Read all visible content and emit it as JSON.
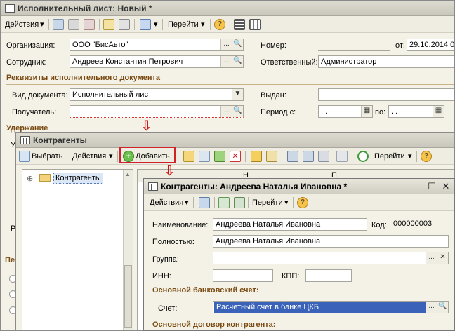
{
  "main_window": {
    "title": "Исполнительный лист: Новый *",
    "toolbar": {
      "actions": "Действия",
      "goto": "Перейти"
    },
    "org_label": "Организация:",
    "org_value": "ООО \"БисАвто\"",
    "number_label": "Номер:",
    "number_value": "",
    "date_label": "от:",
    "date_value": "29.10.2014  0",
    "employee_label": "Сотрудник:",
    "employee_value": "Андреев Константин Петрович",
    "responsible_label": "Ответственный:",
    "responsible_value": "Администратор",
    "section_requisites": "Реквизиты исполнительного документа",
    "doc_type_label": "Вид документа:",
    "doc_type_value": "Исполнительный лист",
    "issued_label": "Выдан:",
    "issued_value": "",
    "recipient_label": "Получатель:",
    "recipient_value": "",
    "period_label": "Период с:",
    "period_from": " .  .",
    "period_to_label": "по:",
    "period_to": " .  .",
    "section_deduction": "Удержание",
    "partial_labels": {
      "u": "У",
      "r": "Р",
      "pe": "Пе"
    }
  },
  "contractors_window": {
    "title": "Контрагенты",
    "toolbar": {
      "select": "Выбрать",
      "actions": "Действия",
      "add": "Добавить",
      "goto": "Перейти"
    },
    "tree_root": "Контрагенты",
    "col_fragments": {
      "c1": "Н",
      "c2": "П"
    }
  },
  "card_window": {
    "title": "Контрагенты: Андреева Наталья Ивановна *",
    "toolbar": {
      "actions": "Действия",
      "goto": "Перейти"
    },
    "name_label": "Наименование:",
    "name_value": "Андреева Наталья Ивановна",
    "code_label": "Код:",
    "code_value": "000000003",
    "full_label": "Полностью:",
    "full_value": "Андреева Наталья Ивановна",
    "group_label": "Группа:",
    "group_value": "",
    "inn_label": "ИНН:",
    "inn_value": "",
    "kpp_label": "КПП:",
    "kpp_value": "",
    "section_bank": "Основной банковский счет:",
    "account_label": "Счет:",
    "account_value": "Расчетный счет в банке ЦКБ",
    "section_contract": "Основной договор контрагента:"
  },
  "colors": {
    "section": "#7a4a12",
    "highlight": "#d0202a",
    "selected_field": "#3a62b8"
  }
}
